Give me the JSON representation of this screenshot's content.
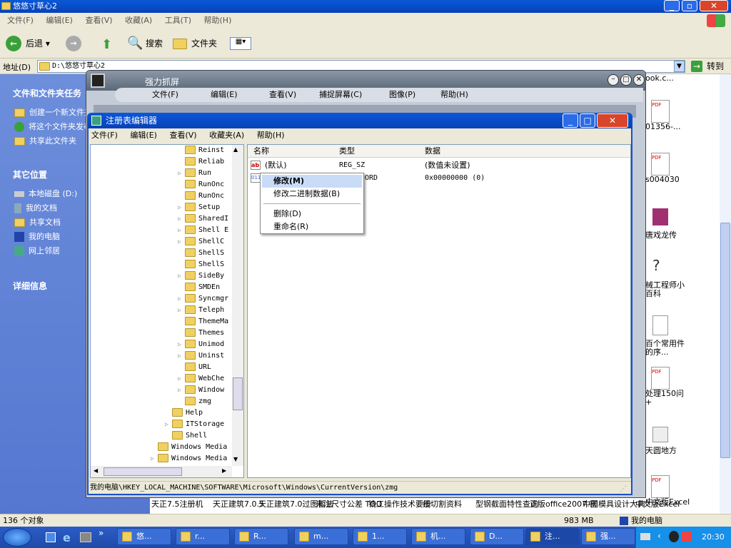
{
  "explorer": {
    "title": "悠悠寸草心2",
    "menu": [
      "文件(F)",
      "编辑(E)",
      "查看(V)",
      "收藏(A)",
      "工具(T)",
      "帮助(H)"
    ],
    "toolbar": {
      "back": "后退",
      "search": "搜索",
      "folders": "文件夹"
    },
    "address_label": "地址(D)",
    "address_value": "D:\\悠悠寸草心2",
    "go_label": "转到",
    "tasks_title": "文件和文件夹任务",
    "tasks": [
      "创建一个新文件夹",
      "将这个文件夹发布",
      "共享此文件夹"
    ],
    "places_title": "其它位置",
    "places": [
      "本地磁盘 (D:)",
      "我的文档",
      "共享文档",
      "我的电脑",
      "网上邻居"
    ],
    "details_title": "详细信息",
    "status_left": "136 个对象",
    "status_size": "983 MB",
    "status_right": "我的电脑",
    "files_right": [
      "ook.c...",
      "01356-...",
      "s004030",
      "唐戏龙传",
      "械工程师小百科",
      "百个常用件的序...",
      "处理150问+",
      "天圆地方",
      "中文版Excel"
    ],
    "files_bottom": [
      "天正7.5注册机",
      "天正建筑7.0.5",
      "天正建筑7.0过图暂法",
      "未注尺寸公差 TOO",
      "铣工操作技术要册",
      "线切割资料",
      "型钢截面特性查询",
      "正版office2007.密",
      "中国模具设计大典",
      "中文版Excel"
    ]
  },
  "capture": {
    "title": "强力抓屏",
    "menu": [
      "文件(F)",
      "编辑(E)",
      "查看(V)",
      "捕捉屏幕(C)",
      "图像(P)",
      "帮助(H)"
    ]
  },
  "regedit": {
    "title": "注册表编辑器",
    "menu": [
      "文件(F)",
      "编辑(E)",
      "查看(V)",
      "收藏夹(A)",
      "帮助(H)"
    ],
    "tree_items": [
      "Reinst",
      "Reliab",
      "Run",
      "RunOnc",
      "RunOnc",
      "Setup",
      "SharedI",
      "Shell E",
      "ShellC",
      "ShellS",
      "ShellS",
      "SideBy",
      "SMDEn",
      "Syncmgr",
      "Teleph",
      "ThemeMa",
      "Themes",
      "Unimod",
      "Uninst",
      "URL",
      "WebChe",
      "Window",
      "zmg"
    ],
    "tree_lower": [
      "Help",
      "ITStorage",
      "Shell",
      "Windows Media",
      "Windows Media"
    ],
    "columns": [
      "名称",
      "类型",
      "数据"
    ],
    "rows": [
      {
        "name": "(默认)",
        "type": "REG_SZ",
        "data": "(数值未设置)"
      },
      {
        "name": "",
        "type": "ORD",
        "data": "0x00000000 (0)"
      }
    ],
    "status": "我的电脑\\HKEY_LOCAL_MACHINE\\SOFTWARE\\Microsoft\\Windows\\CurrentVersion\\zmg"
  },
  "context_menu": {
    "items": [
      "修改(M)",
      "修改二进制数据(B)",
      "删除(D)",
      "重命名(R)"
    ]
  },
  "taskbar": {
    "tasks": [
      "悠...",
      "r...",
      "R...",
      "m...",
      "1...",
      "机...",
      "D...",
      "注...",
      "强..."
    ],
    "clock": "20:30"
  }
}
